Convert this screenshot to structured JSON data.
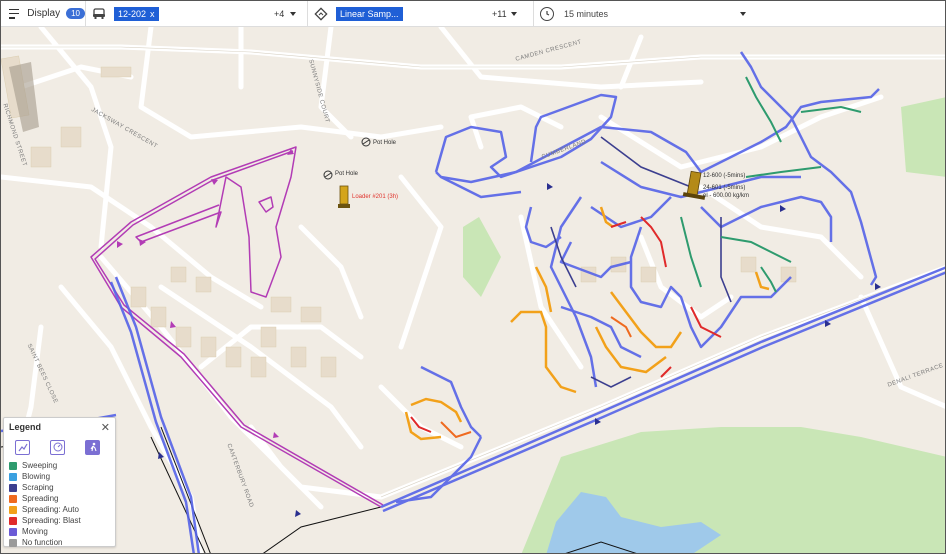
{
  "toolbar": {
    "display_label": "Display",
    "display_badge": "10",
    "vehicle_chip": "12-202",
    "vehicle_chip_close": "x",
    "vehicle_more": "+4",
    "function_chip": "Linear Samp...",
    "function_more": "+11",
    "time_value": "15 minutes"
  },
  "map": {
    "street_labels": [
      "RICHMOND STREET",
      "JACKSWAY CRESCENT",
      "SUNNYSIDE COURT",
      "CAMDEN CRESCENT",
      "CUMBERLAND",
      "SAINT BEES CLOSE",
      "CANTERBURY ROAD",
      "DENALI TERRACE"
    ],
    "pois": [
      {
        "label": "Pot Hole",
        "icon": "pothole-icon"
      },
      {
        "label": "Pot Hole",
        "icon": "pothole-icon"
      }
    ],
    "vehicles": [
      {
        "label": "Loader #201 (3h)",
        "icon": "loader-icon"
      },
      {
        "label": "12-600 (-5mins)",
        "icon": "truck-icon"
      },
      {
        "label": "24-601 (-5mins)",
        "icon": "truck-icon"
      },
      {
        "label": "el - 600.00 kg/km",
        "icon": ""
      }
    ]
  },
  "legend": {
    "title": "Legend",
    "close": "✕",
    "items": [
      {
        "label": "Sweeping",
        "color": "#2e9b6e"
      },
      {
        "label": "Blowing",
        "color": "#3aa0e0"
      },
      {
        "label": "Scraping",
        "color": "#3c3f8f"
      },
      {
        "label": "Spreading",
        "color": "#ef6a1f"
      },
      {
        "label": "Spreading: Auto",
        "color": "#f2a11a"
      },
      {
        "label": "Spreading: Blast",
        "color": "#e02a2a"
      },
      {
        "label": "Moving",
        "color": "#6b5bd6"
      },
      {
        "label": "No function",
        "color": "#9a9a9a"
      }
    ]
  },
  "colors": {
    "accent": "#1f5fd6",
    "route_purple": "#b23cb5",
    "route_blue": "#4a5ae0"
  }
}
